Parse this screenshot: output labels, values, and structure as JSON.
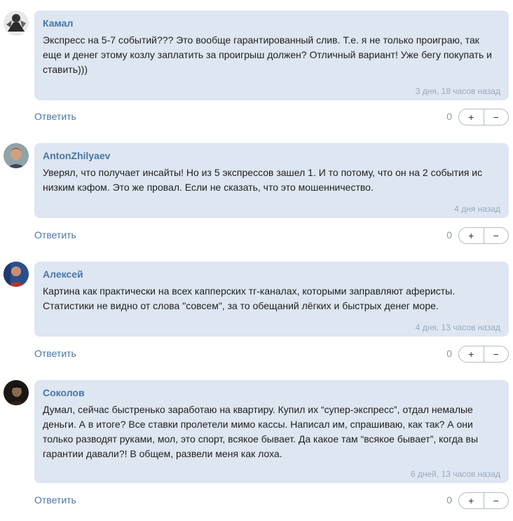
{
  "comments": [
    {
      "author": "Камал",
      "avatar_icon": "avatar-photo-grayscale",
      "text": "Экспресс на 5-7 событий??? Это вообще гарантированный слив. Т.е. я не только проиграю, так еще и денег этому козлу заплатить за проигрыш должен? Отличный вариант! Уже бегу покупать и ставить)))",
      "time": "3 дня, 18 часов назад",
      "reply": "Ответить",
      "score": "0",
      "plus": "+",
      "minus": "−"
    },
    {
      "author": "AntonZhilyaev",
      "avatar_icon": "avatar-photo-man",
      "text": "Уверял, что получает инсайты! Но из 5 экспрессов зашел 1. И то потому, что он на 2 события ис низким кэфом. Это же провал. Если не сказать, что это мошенничество.",
      "time": "4 дня назад",
      "reply": "Ответить",
      "score": "0",
      "plus": "+",
      "minus": "−"
    },
    {
      "author": "Алексей",
      "avatar_icon": "avatar-photo-blue",
      "text": "Картина как практически на всех капперских тг-каналах, которыми заправляют аферисты. Статистики не видно от слова \"совсем\", за то обещаний лёгких и быстрых денег море.",
      "time": "4 дня, 13 часов назад",
      "reply": "Ответить",
      "score": "0",
      "plus": "+",
      "minus": "−"
    },
    {
      "author": "Соколов",
      "avatar_icon": "avatar-photo-dark",
      "text": "Думал, сейчас быстренько заработаю на квартиру. Купил их “супер-экспресс”, отдал немалые деньги. А в итоге? Все ставки пролетели мимо кассы. Написал им, спрашиваю, как так? А они только разводят руками, мол, это спорт, всякое бывает. Да какое там “всякое бывает”, когда вы гарантии давали?! В общем, развели меня как лоха.",
      "time": "6 дней, 13 часов назад",
      "reply": "Ответить",
      "score": "0",
      "plus": "+",
      "minus": "−"
    }
  ],
  "colors": {
    "bubble": "#dde6f1",
    "link": "#4a76a8",
    "time": "#9aaabf"
  }
}
